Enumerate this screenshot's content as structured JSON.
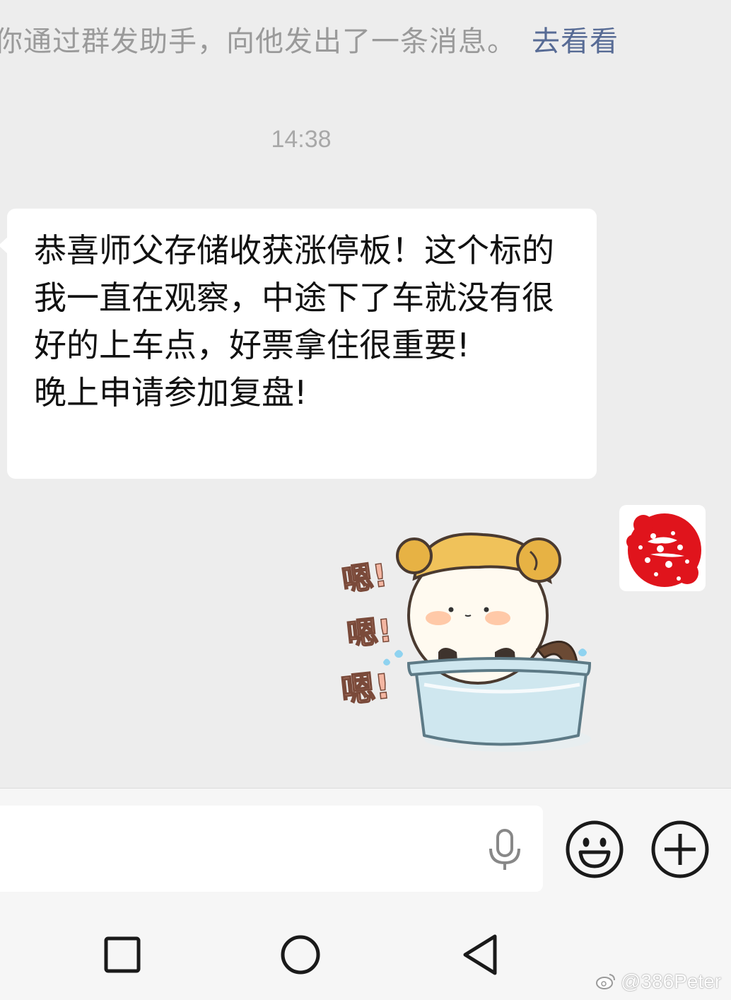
{
  "system_notice": {
    "text": "你通过群发助手，向他发出了一条消息。",
    "link": "去看看"
  },
  "timestamp": "14:38",
  "message": {
    "text": "恭喜师父存储收获涨停板！这个标的我一直在观察，中途下了车就没有很好的上车点，好票拿住很重要!\n晚上申请参加复盘!"
  },
  "sticker": {
    "words": [
      "嗯!",
      "嗯!",
      "嗯!"
    ]
  },
  "watermark": "@386Peter",
  "colors": {
    "background": "#ededed",
    "bubble": "#ffffff",
    "link": "#576b95",
    "avatar_red": "#e0141c"
  }
}
